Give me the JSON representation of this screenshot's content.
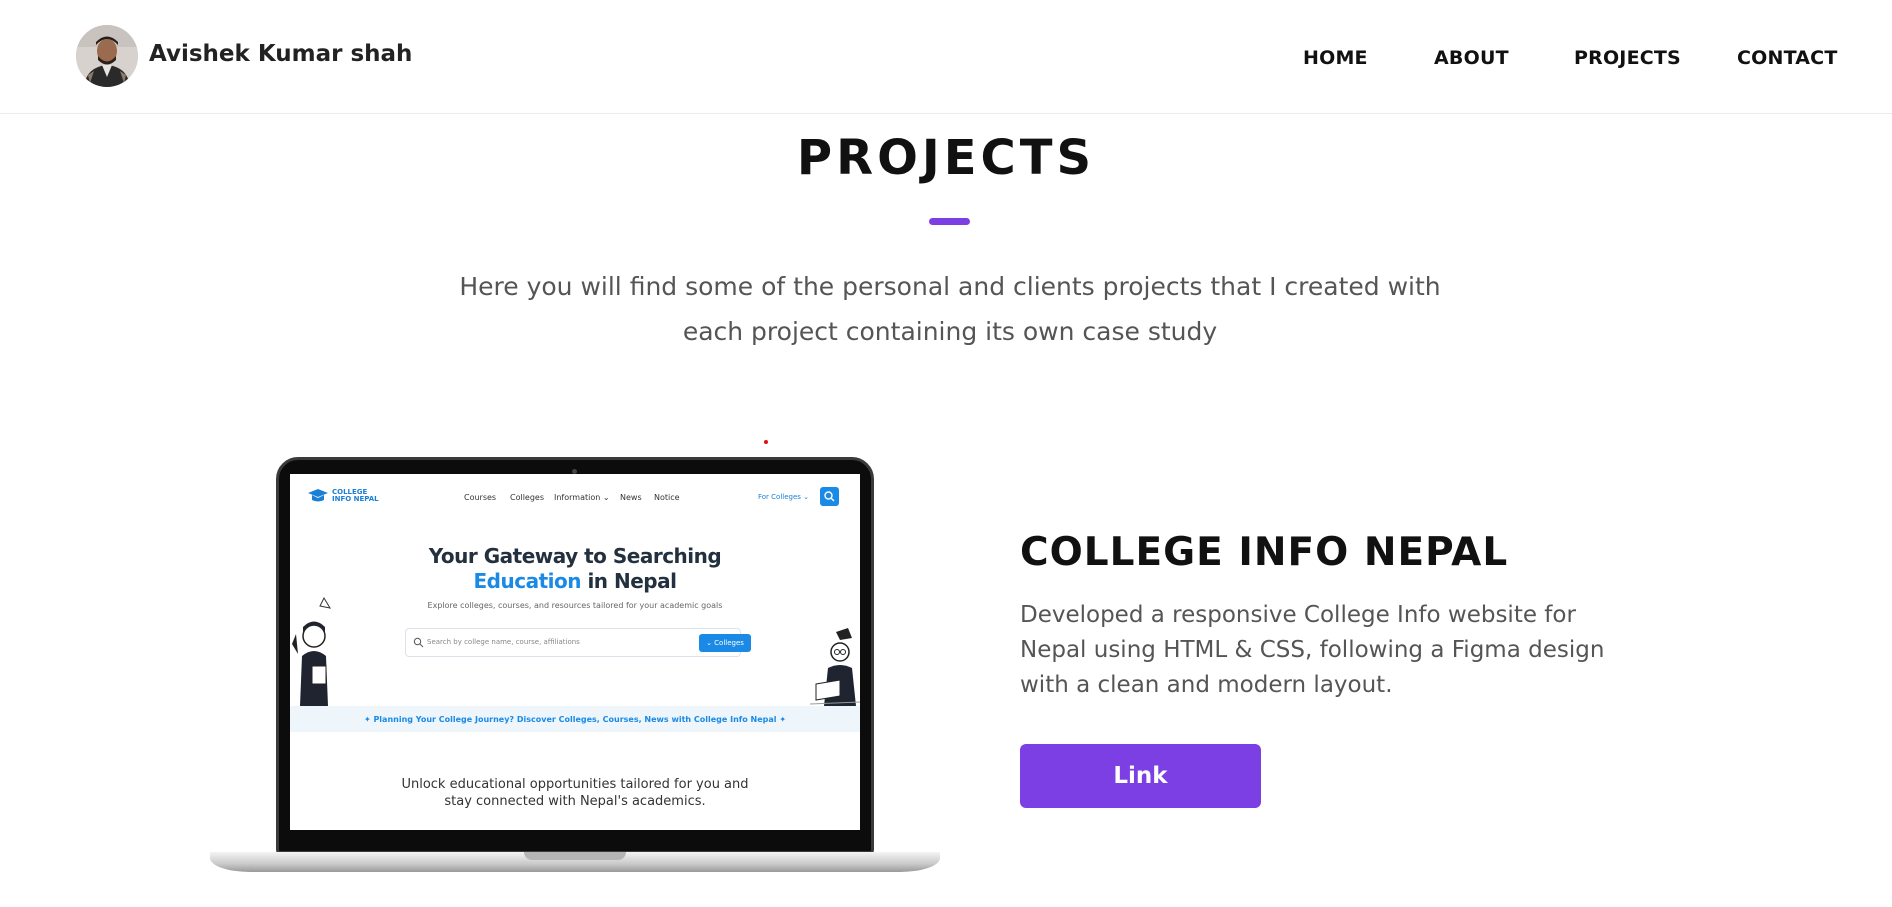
{
  "header": {
    "name": "Avishek Kumar shah",
    "nav": [
      "HOME",
      "ABOUT",
      "PROJECTS",
      "CONTACT"
    ]
  },
  "section": {
    "title": "PROJECTS",
    "description": "Here you will find some of the personal and clients projects that I created with each project containing its own case study",
    "accent_color": "#7b3fe4"
  },
  "project": {
    "title": "COLLEGE INFO NEPAL",
    "description": "Developed a responsive College Info website for Nepal using HTML & CSS, following a Figma design with a clean and modern layout.",
    "link_label": "Link",
    "preview": {
      "logo_line1": "COLLEGE",
      "logo_line2": "INFO NEPAL",
      "nav": [
        "Courses",
        "Colleges",
        "Information ⌄",
        "News",
        "Notice"
      ],
      "for_colleges": "For Colleges ⌄",
      "hero_line1": "Your Gateway to Searching",
      "hero_blue": "Education",
      "hero_rest": " in Nepal",
      "subtitle": "Explore colleges, courses, and resources tailored for your academic goals",
      "search_placeholder": "Search by college name, course, affiliations",
      "search_button": "⌄ Colleges",
      "banner": "✦ Planning Your College Journey? Discover Colleges, Courses, News with College Info Nepal ✦",
      "unlock": "Unlock educational opportunities tailored for you and stay connected with Nepal's academics.",
      "brand_color": "#1a8ae6"
    }
  }
}
